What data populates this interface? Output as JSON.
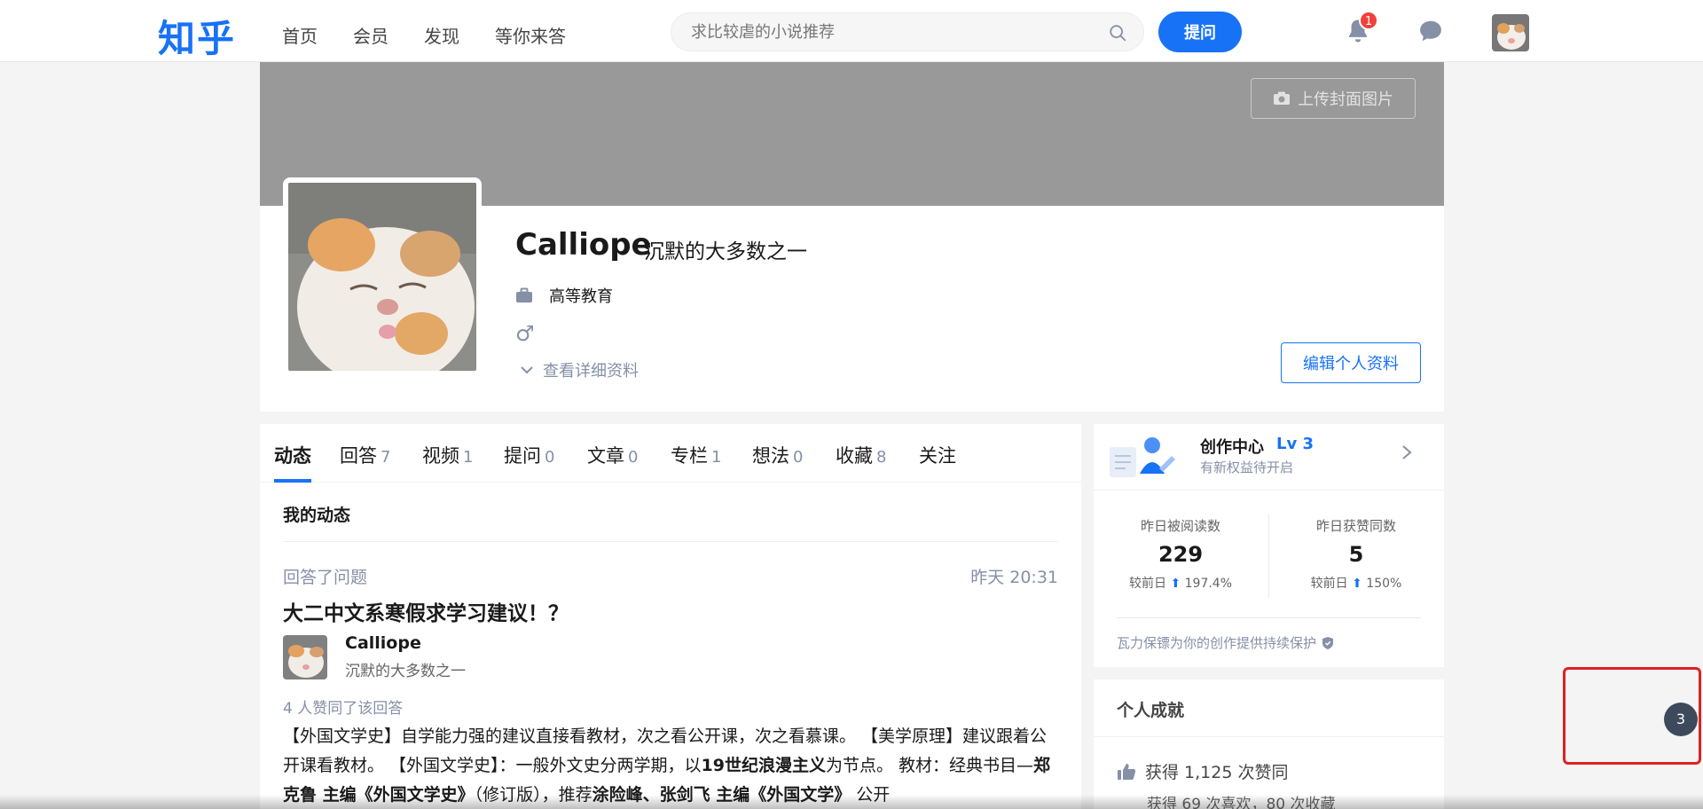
{
  "header": {
    "logo": "知乎",
    "nav": [
      "首页",
      "会员",
      "发现",
      "等你来答"
    ],
    "search_placeholder": "求比较虐的小说推荐",
    "ask_label": "提问",
    "notification_count": "1"
  },
  "profile": {
    "upload_cover_label": "上传封面图片",
    "name": "Calliope",
    "headline": "沉默的大多数之一",
    "industry": "高等教育",
    "gender_symbol": "♂",
    "detail_link": "查看详细资料",
    "edit_button": "编辑个人资料"
  },
  "tabs": [
    {
      "label": "动态",
      "count": ""
    },
    {
      "label": "回答",
      "count": "7"
    },
    {
      "label": "视频",
      "count": "1"
    },
    {
      "label": "提问",
      "count": "0"
    },
    {
      "label": "文章",
      "count": "0"
    },
    {
      "label": "专栏",
      "count": "1"
    },
    {
      "label": "想法",
      "count": "0"
    },
    {
      "label": "收藏",
      "count": "8"
    },
    {
      "label": "关注",
      "count": ""
    }
  ],
  "feed": {
    "section_title": "我的动态",
    "item": {
      "action": "回答了问题",
      "time": "昨天 20:31",
      "title": "大二中文系寒假求学习建议！？",
      "author_name": "Calliope",
      "author_headline": "沉默的大多数之一",
      "votes": "4 人赞同了该回答",
      "excerpt_html_parts": [
        {
          "t": "【外国文学史】自学能力强的建议直接看教材，次之看公开课，次之看慕课。 【美学原理】建议跟着公开课看教材。 【外国文学史】：一般外文史分两学期，以",
          "b": false
        },
        {
          "t": "19世纪浪漫主义",
          "b": true
        },
        {
          "t": "为节点。 教材：经典书目—",
          "b": false
        },
        {
          "t": "郑克鲁 主编《外国文学史》",
          "b": true
        },
        {
          "t": "（修订版），推荐",
          "b": false
        },
        {
          "t": "涂险峰、张剑飞 主编《外国文学》",
          "b": true
        },
        {
          "t": " 公开",
          "b": false
        }
      ]
    }
  },
  "creator": {
    "title": "创作中心",
    "level": "Lv 3",
    "subtitle": "有新权益待开启",
    "stats": [
      {
        "label": "昨日被阅读数",
        "value": "229",
        "cmp_prefix": "较前日",
        "cmp_value": "197.4%"
      },
      {
        "label": "昨日获赞同数",
        "value": "5",
        "cmp_prefix": "较前日",
        "cmp_value": "150%"
      }
    ],
    "protect_text": "瓦力保镖为你的创作提供持续保护"
  },
  "achievements": {
    "title": "个人成就",
    "upvotes": "获得 1,125 次赞同",
    "likes_favs": "获得 69 次喜欢，80 次收藏"
  },
  "floating": {
    "badge": "3"
  },
  "colors": {
    "brand": "#1772f6",
    "cover": "#999999",
    "badge": "#f1403c"
  }
}
